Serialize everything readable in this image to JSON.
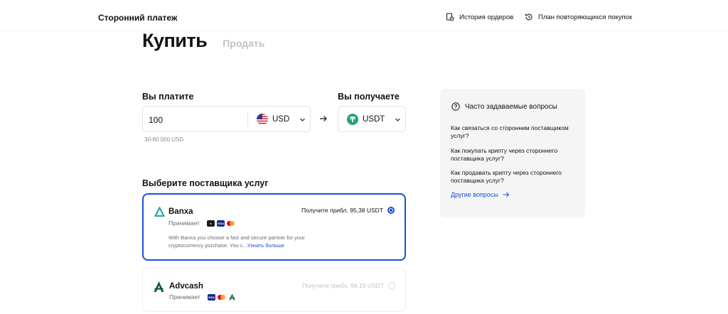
{
  "header": {
    "brand": "Сторонний платеж",
    "order_history": "История ордеров",
    "recurring_plan": "План повторяющихся покупок"
  },
  "tabs": {
    "buy": "Купить",
    "sell": "Продать"
  },
  "pay": {
    "label": "Вы платите",
    "amount": "100",
    "currency": "USD",
    "range": "30-80 000 USD"
  },
  "receive": {
    "label": "Вы получаете",
    "currency": "USDT"
  },
  "providers": {
    "title": "Выберите поставщика услуг",
    "items": [
      {
        "name": "Banxa",
        "accepts": "Принимает",
        "estimate": "Получите прибл. 95,38 USDT",
        "description": "With Banxa you choose a fast and secure partner for your cryptocurrency purchase. You c...",
        "learn_more": "Узнать больше",
        "selected": true
      },
      {
        "name": "Advcash",
        "accepts": "Принимает",
        "estimate": "Получите прибл. 96,15 USDT",
        "selected": false
      }
    ]
  },
  "faq": {
    "title": "Часто задаваемые вопросы",
    "questions": [
      "Как связаться со сторонним поставщиком услуг?",
      "Как покупать крипту через стороннего поставщика услуг?",
      "Как продавать крипту через стороннего поставщика услуг?"
    ],
    "more": "Другие вопросы"
  },
  "colors": {
    "accent": "#1a4fd6",
    "tether": "#26a17b",
    "banxa": "#1aa3a3",
    "muted": "#c2c2c2"
  }
}
